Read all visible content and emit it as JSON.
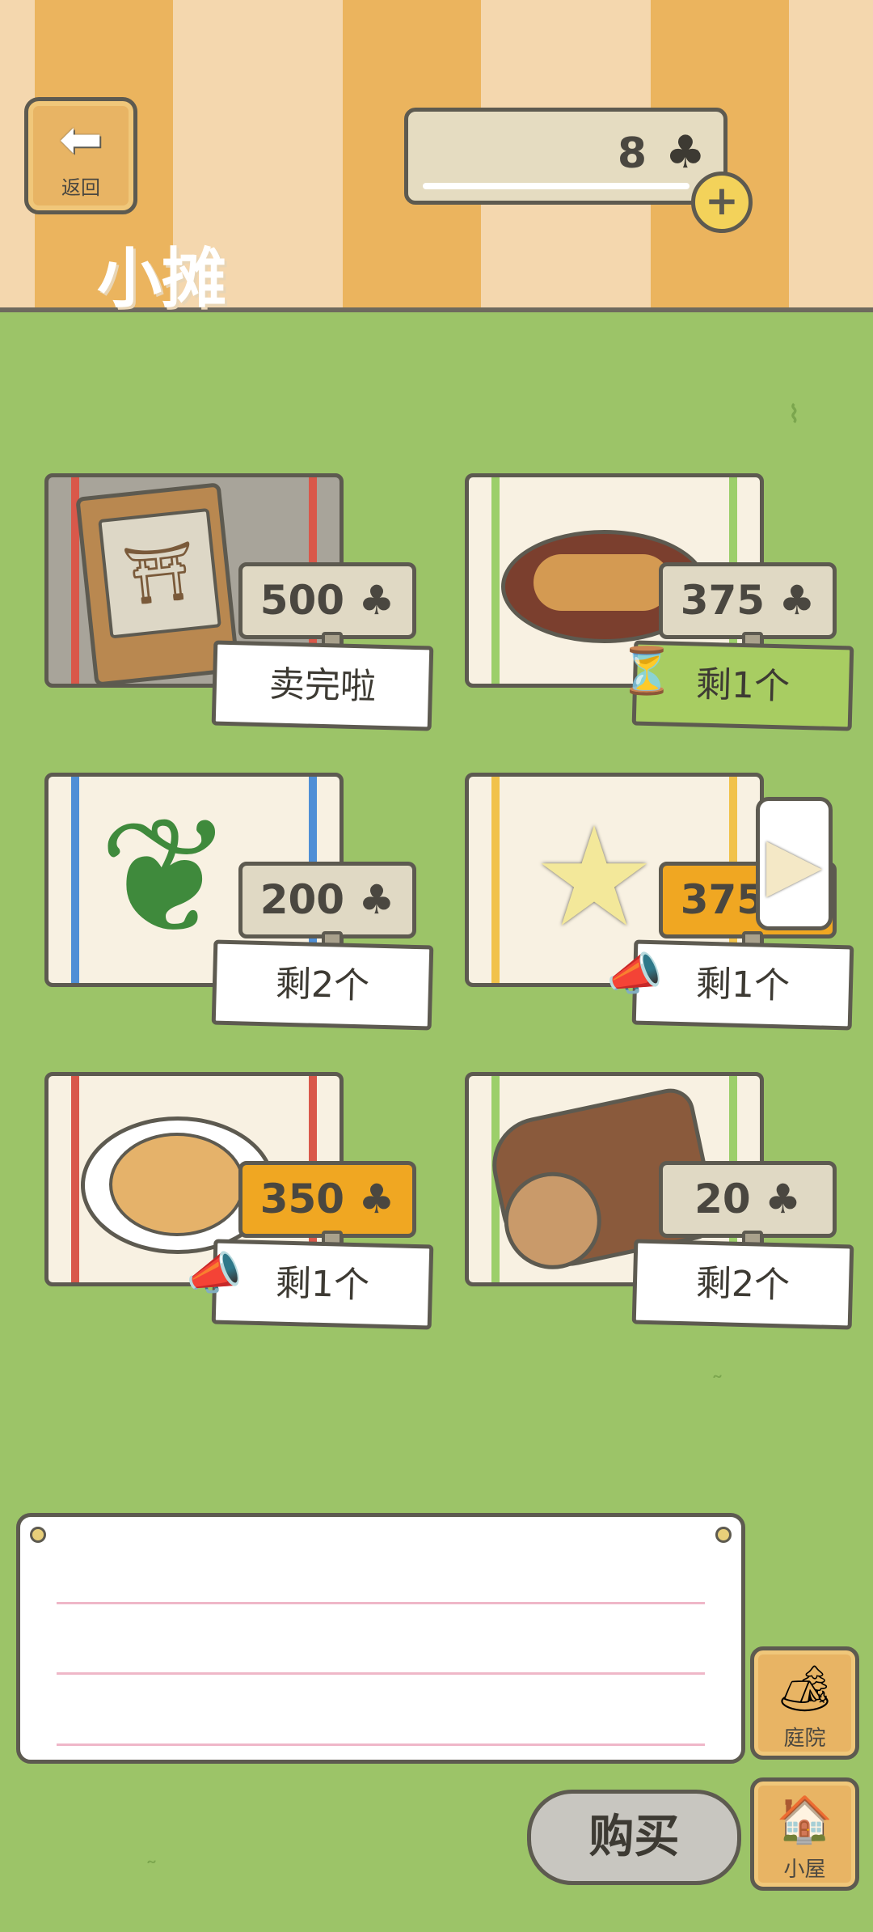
{
  "header": {
    "back_label": "返回",
    "clover_count": "8",
    "title": "小摊"
  },
  "stalls": [
    {
      "price": "500",
      "status": "卖完啦",
      "item": "book-stool",
      "hot": false
    },
    {
      "price": "375",
      "status": "剩1个",
      "item": "grilled-dish",
      "hot": false
    },
    {
      "price": "200",
      "status": "剩2个",
      "item": "leaf",
      "hot": false
    },
    {
      "price": "375",
      "status": "剩1个",
      "item": "star-cookies",
      "hot": true
    },
    {
      "price": "350",
      "status": "剩1个",
      "item": "bread",
      "hot": true
    },
    {
      "price": "20",
      "status": "剩2个",
      "item": "log",
      "hot": false
    }
  ],
  "buttons": {
    "buy": "购买",
    "yard": "庭院",
    "house": "小屋"
  },
  "colors": {
    "grass": "#9cc468",
    "header_stripe_dark": "#ebb45e",
    "header_stripe_light": "#f4d7ae",
    "price_hot": "#f0a722",
    "outline": "#5d5a50"
  }
}
